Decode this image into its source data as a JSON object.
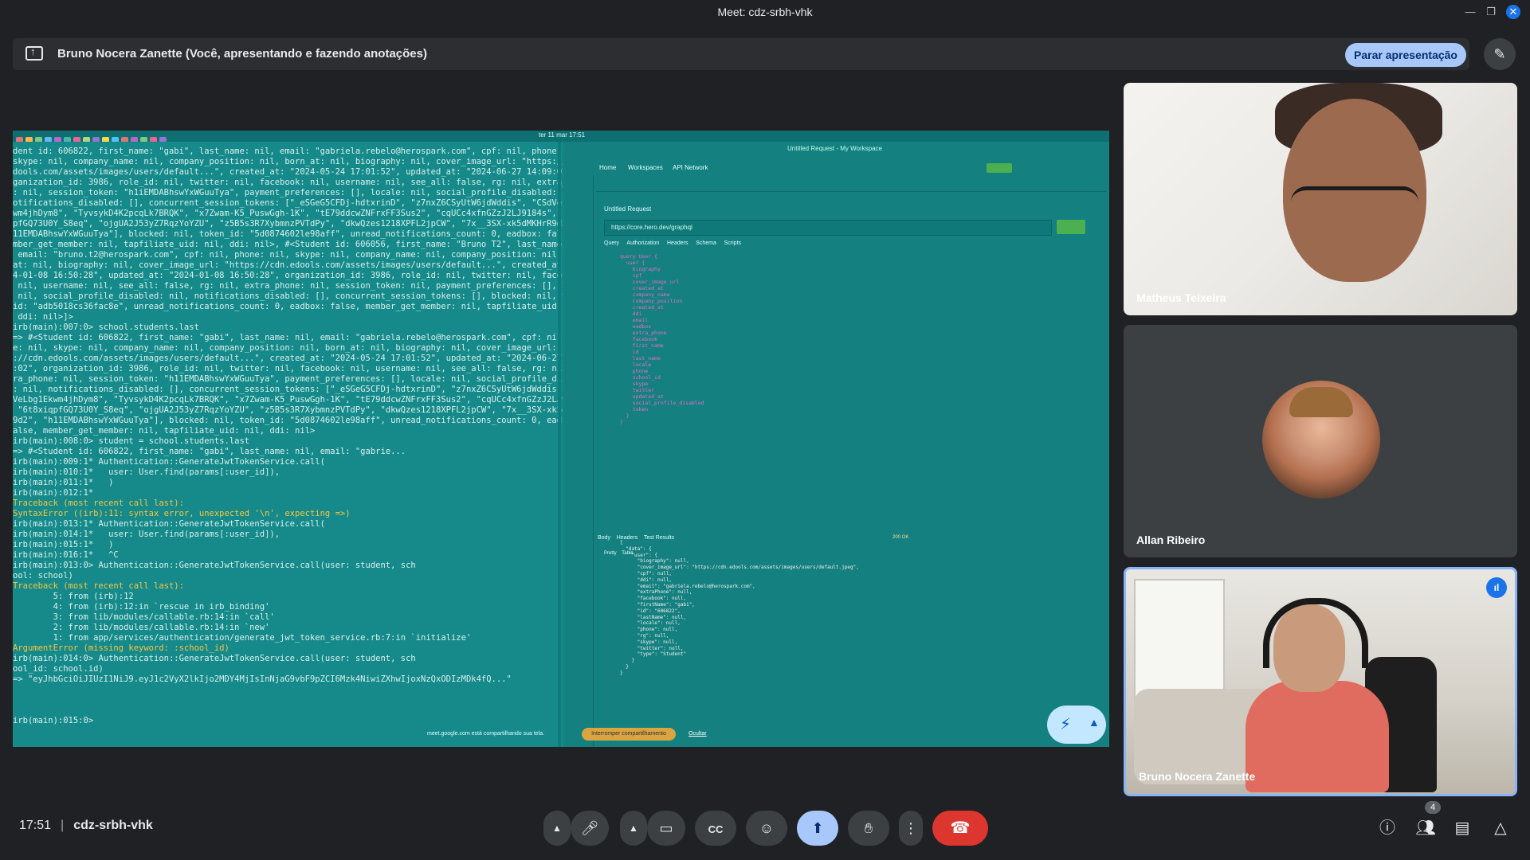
{
  "window": {
    "title": "Meet: cdz-srbh-vhk"
  },
  "banner": {
    "text": "Bruno Nocera Zanette (Você, apresentando e fazendo anotações)",
    "stop_label": "Parar apresentação"
  },
  "screen": {
    "clock": "ter 11 mar 17:51",
    "terminal_lines": [
      "dent id: 606822, first_name: \"gabi\", last_name: nil, email: \"gabriela.rebelo@herospark.com\", cpf: nil, phone: nil,",
      "skype: nil, company_name: nil, company_position: nil, born_at: nil, biography: nil, cover_image_url: \"https://cdn.e",
      "dools.com/assets/images/users/default...\", created_at: \"2024-05-24 17:01:52\", updated_at: \"2024-06-27 14:09:02\", or",
      "ganization_id: 3986, role_id: nil, twitter: nil, facebook: nil, username: nil, see_all: false, rg: nil, extra_phone",
      ": nil, session_token: \"h1iEMDABhswYxWGuuTya\", payment_preferences: [], locale: nil, social_profile_disabled: nil, n",
      "otifications_disabled: [], concurrent_session_tokens: [\"_eSGeG5CFDj-hdtxrinD\", \"z7nxZ6CSyUtW6jdWddis\", \"CSdVeLbg1Ek",
      "wm4jhDym8\", \"TyvsykD4K2pcqLk7BRQK\", \"x7Zwam-K5_PuswGgh-1K\", \"tE79ddcwZNFrxFF3Sus2\", \"cqUCc4xfnGZzJ2LJ9184s\", \"6t8xiq",
      "pfGQ73U0Y_S8eq\", \"ojgUA2J53yZ7RqzYoYZU\", \"z5B5s3R7XybmnzPVTdPy\", \"dkwQzes1218XPFL2jpCW\", \"7x__3SX-xk5dMKHrR9d2\", \"h",
      "11EMDABhswYxWGuuTya\"], blocked: nil, token_id: \"5d0874602le98aff\", unread_notifications_count: 0, eadbox: false, me",
      "mber_get_member: nil, tapfiliate_uid: nil, ddi: nil>, #<Student id: 606056, first_name: \"Bruno T2\", last_name: nil,",
      " email: \"bruno.t2@herospark.com\", cpf: nil, phone: nil, skype: nil, company_name: nil, company_position: nil, born_",
      "at: nil, biography: nil, cover_image_url: \"https://cdn.edools.com/assets/images/users/default...\", created_at: \"202",
      "4-01-08 16:50:28\", updated_at: \"2024-01-08 16:50:28\", organization_id: 3986, role_id: nil, twitter: nil, facebook:",
      " nil, username: nil, see_all: false, rg: nil, extra_phone: nil, session_token: nil, payment_preferences: [], locale:",
      " nil, social_profile_disabled: nil, notifications_disabled: [], concurrent_session_tokens: [], blocked: nil, token_",
      "id: \"adb5018cs36fac8e\", unread_notifications_count: 0, eadbox: false, member_get_member: nil, tapfiliate_uid: nil,",
      " ddi: nil>]>",
      "irb(main):007:0> school.students.last",
      "=> #<Student id: 606822, first_name: \"gabi\", last_name: nil, email: \"gabriela.rebelo@herospark.com\", cpf: nil, phon",
      "e: nil, skype: nil, company_name: nil, company_position: nil, born_at: nil, biography: nil, cover_image_url: \"https",
      "://cdn.edools.com/assets/images/users/default...\", created_at: \"2024-05-24 17:01:52\", updated_at: \"2024-06-27 14:09",
      ":02\", organization_id: 3986, role_id: nil, twitter: nil, facebook: nil, username: nil, see_all: false, rg: nil, ext",
      "ra_phone: nil, session_token: \"h11EMDABhswYxWGuuTya\", payment_preferences: [], locale: nil, social_profile_disabled",
      ": nil, notifications_disabled: [], concurrent_session_tokens: [\"_eSGeG5CFDj-hdtxrinD\", \"z7nxZ6CSyUtW6jdWddis\", \"CSd",
      "VeLbg1Ekwm4jhDym8\", \"TyvsykD4K2pcqLk7BRQK\", \"x7Zwam-K5_PuswGgh-1K\", \"tE79ddcwZNFrxFF3Sus2\", \"cqUCc4xfnGZzJ2LJ9184s\",",
      " \"6t8xiqpfGQ73U0Y_S8eq\", \"ojgUA2J53yZ7RqzYoYZU\", \"z5B5s3R7XybmnzPVTdPy\", \"dkwQzes1218XPFL2jpCW\", \"7x__3SX-xk5dMKHrR",
      "9d2\", \"h11EMDABhswYxWGuuTya\"], blocked: nil, token_id: \"5d0874602le98aff\", unread_notifications_count: 0, eadbox: f",
      "alse, member_get_member: nil, tapfiliate_uid: nil, ddi: nil>",
      "irb(main):008:0> student = school.students.last",
      "=> #<Student id: 606822, first_name: \"gabi\", last_name: nil, email: \"gabrie...",
      "irb(main):009:1* Authentication::GenerateJwtTokenService.call(",
      "irb(main):010:1*   user: User.find(params[:user_id]),",
      "irb(main):011:1*   )",
      "irb(main):012:1*",
      "Traceback (most recent call last):",
      "SyntaxError ((irb):11: syntax error, unexpected '\\n', expecting =>)",
      "irb(main):013:1* Authentication::GenerateJwtTokenService.call(",
      "irb(main):014:1*   user: User.find(params[:user_id]),",
      "irb(main):015:1*   )",
      "irb(main):016:1*   ^C",
      "irb(main):013:0> Authentication::GenerateJwtTokenService.call(user: student, sch",
      "ool: school)",
      "Traceback (most recent call last):",
      "        5: from (irb):12",
      "        4: from (irb):12:in `rescue in irb_binding'",
      "        3: from lib/modules/callable.rb:14:in `call'",
      "        2: from lib/modules/callable.rb:14:in `new'",
      "        1: from app/services/authentication/generate_jwt_token_service.rb:7:in `initialize'",
      "ArgumentError (missing keyword: :school_id)",
      "irb(main):014:0> Authentication::GenerateJwtTokenService.call(user: student, sch",
      "ool_id: school.id)",
      "=> \"eyJhbGciOiJIUzI1NiJ9.eyJ1c2VyX2lkIjo2MDY4MjIsInNjaG9vbF9pZCI6Mzk4NiwiZXhwIjoxNzQxODIzMDk4fQ...\"",
      "",
      "",
      "",
      "irb(main):015:0> "
    ],
    "postman": {
      "window_title": "Untitled Request - My Workspace",
      "nav": [
        "Home",
        "Workspaces",
        "API Network"
      ],
      "request_title": "Untitled Request",
      "url": "https://core.hero.dev/graphql",
      "query_button": "Query",
      "tabs": [
        "Query",
        "Authorization",
        "Headers",
        "Schema",
        "Scripts"
      ],
      "response_tabs": [
        "Body",
        "Headers",
        "Test Results"
      ],
      "view_tabs": [
        "Pretty",
        "Table"
      ],
      "status": "200 OK"
    },
    "share_notice": "meet.google.com está compartilhando sua tela.",
    "share_stop": "Interromper compartilhamento",
    "share_hide": "Ocultar"
  },
  "participants": [
    {
      "name": "Matheus Teixeira"
    },
    {
      "name": "Allan Ribeiro"
    },
    {
      "name": "Bruno Nocera Zanette"
    }
  ],
  "bottom": {
    "time": "17:51",
    "meeting_code": "cdz-srbh-vhk",
    "people_count": "4"
  },
  "icons": {
    "mic": "mic-icon",
    "camera": "camera-icon",
    "captions": "captions-icon",
    "emoji": "emoji-icon",
    "present": "present-icon",
    "hand": "raise-hand-icon",
    "more": "more-vert-icon",
    "end": "end-call-icon",
    "info": "info-icon",
    "people": "people-icon",
    "chat": "chat-icon",
    "activities": "activities-icon"
  },
  "colors": {
    "accent": "#a8c7fa",
    "end_call": "#dc362e",
    "background": "#202124"
  }
}
